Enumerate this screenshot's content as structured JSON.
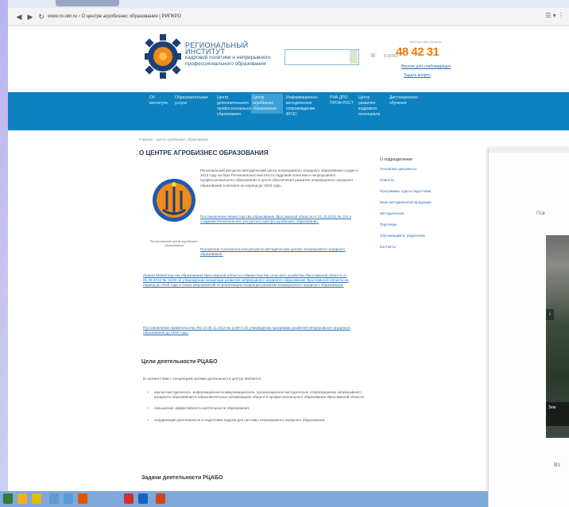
{
  "browser": {
    "url": "www.ro-obr.ru › О центре агробизнес образования | РИПКРО",
    "menu_glyph": "☰ ▾ ⋮"
  },
  "header": {
    "institute_lines": [
      "РЕГИОНАЛЬНЫЙ ИНСТИТУТ",
      "кадровой политики и непрерывного",
      "профессионального образования"
    ],
    "phone_caption": "телефон для справок",
    "phone_code": "8 (8142)",
    "phone_number": "48 42 31",
    "links": [
      "Версия для слабовидящих",
      "Задать вопрос"
    ]
  },
  "nav": {
    "items": [
      {
        "label": "Об институте"
      },
      {
        "label": "Образовательные услуги"
      },
      {
        "label": "Центр дополнительного профессионального образования"
      },
      {
        "label": "Центр агробизнес образования"
      },
      {
        "label": "Информационно-методическое сопровождение ФГОС"
      },
      {
        "label": "РИА ДПО ПРОФ-РОСТ"
      },
      {
        "label": "Центр развития кадрового потенциала"
      },
      {
        "label": "Дистанционное обучение"
      }
    ]
  },
  "content": {
    "breadcrumb": "Главная › Центр агробизнес образования",
    "title": "О ЦЕНТРЕ АГРОБИЗНЕС ОБРАЗОВАНИЯ",
    "intro": "Региональный ресурсно-методический центр непрерывного аграрного образования создан в 2013 году на базе Регионального института кадровой политики и непрерывного профессионального образования в целях обеспечения развития непрерывного аграрного образования в регионе на период до 2020 года.",
    "emblem_caption": "Региональный центр агробизнес образования",
    "link1": "Постановление Министерства образования Ярославской области от 21.10.2013 № 144 о создании Регионального ресурсного центра агробизнес образования.",
    "link2": "Положение о региональном ресурсно-методическом центре непрерывного аграрного образования.",
    "link3": "Приказ Министерства образования Ярославской области и Министерства сельского хозяйства Ярославской области от 05.09.2013 № 15/29 об утверждении концепции развития непрерывного аграрного образования Ярославской области на период до 2020 года и плана мероприятий по реализации концепции развития непрерывного аграрного образования.",
    "link4": "Постановление правительства ЯО от 06.11.2013 № 1449-п об утверждении программы развития непрерывного аграрного образования до 2020 года.",
    "goals_title": "Цели деятельности РЦАБО",
    "goals_intro": "В соответствии с концепцией целями деятельности центра являются:",
    "goals": [
      "научно-методическое, информационно-коммуникационное, организационно-методическое сопровождение непрерывного аграрного образования в образовательных организациях общего и профессионального образования Ярославской области;",
      "повышение эффективности деятельности образования;",
      "координация деятельности и подготовка кадров для системы непрерывного аграрного образования."
    ],
    "tasks_title": "Задачи деятельности РЦАБО"
  },
  "sidebar": {
    "title": "О подразделении",
    "items": [
      "Основные документы",
      "Новости",
      "Программы, курсы подготовки",
      "Банк методической продукции",
      "Методическая",
      "Партнеры",
      "Обучающимся, родителям",
      "Контакты"
    ]
  },
  "overlay": {
    "label": "Пов",
    "caption": "Зем",
    "foot": "Вз"
  },
  "taskbar": {
    "icons": [
      "start",
      "explorer",
      "folder",
      "media",
      "files",
      "browser",
      "yandex",
      "word",
      "powerpoint"
    ],
    "colors": [
      "#2e7d32",
      "#f2b01e",
      "#e6b800",
      "#5a9bd5",
      "#5a9bd5",
      "#e65100",
      "#d32f2f",
      "#1565c0",
      "#d84315"
    ]
  }
}
